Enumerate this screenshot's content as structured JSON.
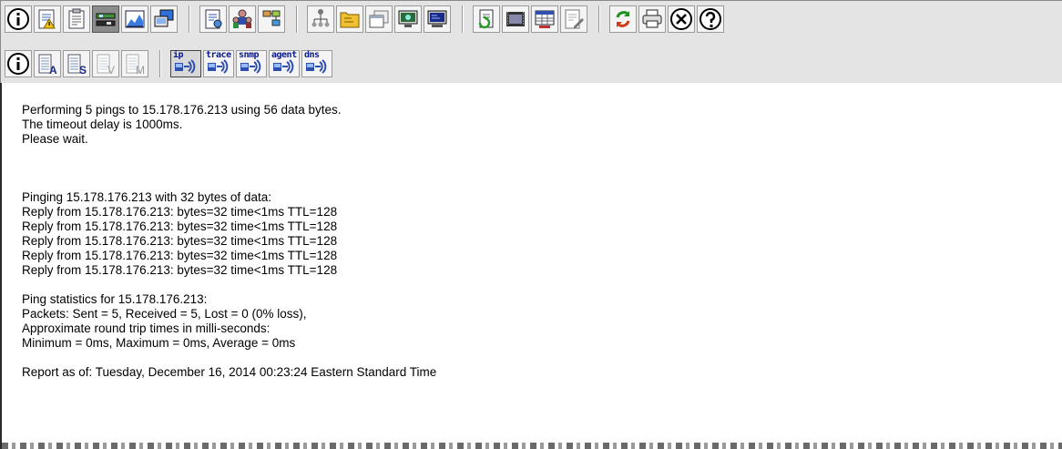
{
  "toolbar": {
    "row1_groups": [
      [
        "info-icon",
        "alert-report-icon",
        "clipboard-icon",
        "tools-pressed-icon",
        "chart-icon",
        "screen-share-icon"
      ],
      [
        "document-report-icon",
        "user-group-icon",
        "network-map-icon"
      ],
      [
        "hierarchy-icon",
        "folder-tree-icon",
        "window-copy-icon",
        "monitor-icon",
        "terminal-icon"
      ],
      [
        "refresh-report-icon",
        "film-icon",
        "database-table-icon",
        "edit-document-icon"
      ],
      [
        "refresh-icon",
        "print-icon",
        "close-icon",
        "help-icon"
      ]
    ],
    "row2_left": [
      "info-icon",
      "log-a-icon",
      "log-s-icon",
      "log-v-icon",
      "log-m-icon"
    ],
    "net_tools": [
      {
        "label": "ip",
        "icon": "ip-tool-icon",
        "pressed": true
      },
      {
        "label": "trace",
        "icon": "trace-tool-icon",
        "pressed": false
      },
      {
        "label": "snmp",
        "icon": "snmp-tool-icon",
        "pressed": false
      },
      {
        "label": "agent",
        "icon": "agent-tool-icon",
        "pressed": false
      },
      {
        "label": "dns",
        "icon": "dns-tool-icon",
        "pressed": false
      }
    ]
  },
  "output": {
    "intro": [
      "Performing 5 pings to 15.178.176.213 using 56 data bytes.",
      "The timeout delay is 1000ms.",
      "Please wait."
    ],
    "pinging": "Pinging 15.178.176.213 with 32 bytes of data:",
    "replies": [
      "Reply from 15.178.176.213: bytes=32 time<1ms TTL=128",
      "Reply from 15.178.176.213: bytes=32 time<1ms TTL=128",
      "Reply from 15.178.176.213: bytes=32 time<1ms TTL=128",
      "Reply from 15.178.176.213: bytes=32 time<1ms TTL=128",
      "Reply from 15.178.176.213: bytes=32 time<1ms TTL=128"
    ],
    "stats": [
      "Ping statistics for 15.178.176.213:",
      "Packets: Sent = 5, Received = 5, Lost = 0 (0% loss),",
      "Approximate round trip times in milli-seconds:",
      "Minimum = 0ms, Maximum = 0ms, Average = 0ms"
    ],
    "report": "Report as of: Tuesday, December 16, 2014 00:23:24 Eastern Standard Time"
  }
}
